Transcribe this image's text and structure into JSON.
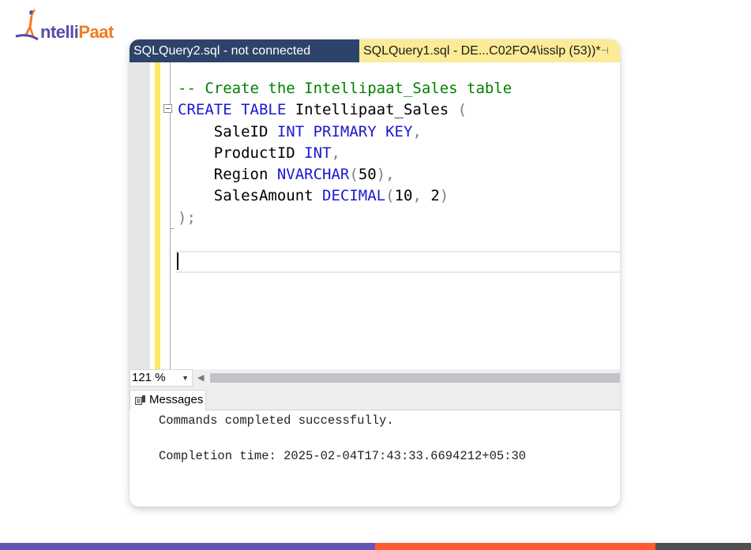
{
  "brand": {
    "logo_part1": "ntelli",
    "logo_part2": "Paat",
    "colors": {
      "purple": "#6556b5",
      "orange": "#f47a20"
    }
  },
  "tabs": [
    {
      "label": "SQLQuery2.sql - not connected",
      "active": false
    },
    {
      "label": "SQLQuery1.sql - DE...C02FO4\\isslp (53))*",
      "active": true,
      "pin_icon": "pin-icon"
    }
  ],
  "editor": {
    "lines": {
      "comment": "-- Create the Intellipaat_Sales table",
      "l2_kw": "CREATE TABLE",
      "l2_name": " Intellipaat_Sales ",
      "l2_paren": "(",
      "l3_col": "    SaleID ",
      "l3_kw": "INT PRIMARY KEY",
      "l3_punc": ",",
      "l4_col": "    ProductID ",
      "l4_kw": "INT",
      "l4_punc": ",",
      "l5_col": "    Region ",
      "l5_kw": "NVARCHAR",
      "l5_open": "(",
      "l5_num": "50",
      "l5_close": "),",
      "l6_col": "    SalesAmount ",
      "l6_kw": "DECIMAL",
      "l6_open": "(",
      "l6_num": "10",
      "l6_comma": ", ",
      "l6_num2": "2",
      "l6_close": ")",
      "l7": ");"
    }
  },
  "zoom": {
    "value": "121 %"
  },
  "messages": {
    "tab_label": "Messages",
    "line1": "Commands completed successfully.",
    "line2": "Completion time: 2025-02-04T17:43:33.6694212+05:30"
  },
  "bottom_bar_colors": [
    "#6556b5",
    "#ff5a30",
    "#505050"
  ]
}
